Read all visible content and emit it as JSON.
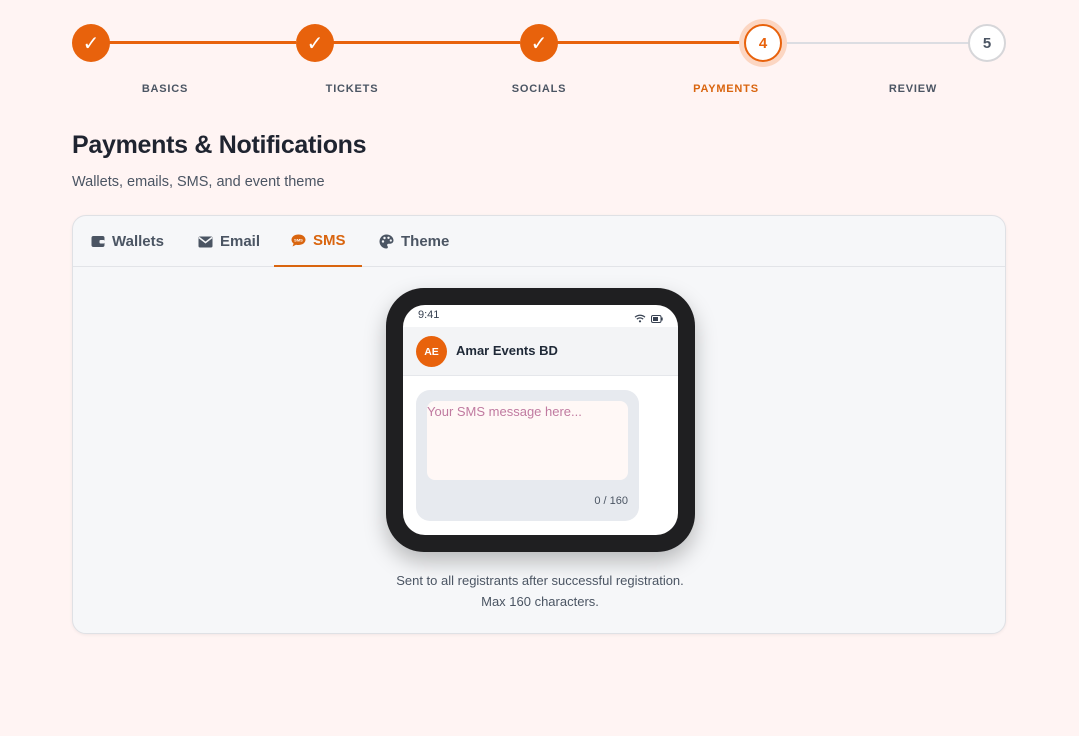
{
  "stepper": {
    "steps": [
      {
        "label": "BASICS",
        "marker": "✓",
        "state": "done"
      },
      {
        "label": "TICKETS",
        "marker": "✓",
        "state": "done"
      },
      {
        "label": "SOCIALS",
        "marker": "✓",
        "state": "done"
      },
      {
        "label": "PAYMENTS",
        "marker": "4",
        "state": "current"
      },
      {
        "label": "REVIEW",
        "marker": "5",
        "state": "todo"
      }
    ]
  },
  "page": {
    "title": "Payments & Notifications",
    "subtitle": "Wallets, emails, SMS, and event theme"
  },
  "tabs": [
    {
      "label": "Wallets",
      "icon": "wallet-icon"
    },
    {
      "label": "Email",
      "icon": "envelope-icon"
    },
    {
      "label": "SMS",
      "icon": "sms-icon",
      "active": true
    },
    {
      "label": "Theme",
      "icon": "palette-icon"
    }
  ],
  "phone": {
    "time": "9:41",
    "avatar_initials": "AE",
    "sender_name": "Amar Events BD",
    "sms_placeholder": "Your SMS message here...",
    "sms_value": "",
    "char_count": "0 / 160"
  },
  "help_text": "Sent to all registrants after successful registration. Max 160 characters.",
  "colors": {
    "accent": "#e8620c",
    "background": "#fff4f3"
  }
}
